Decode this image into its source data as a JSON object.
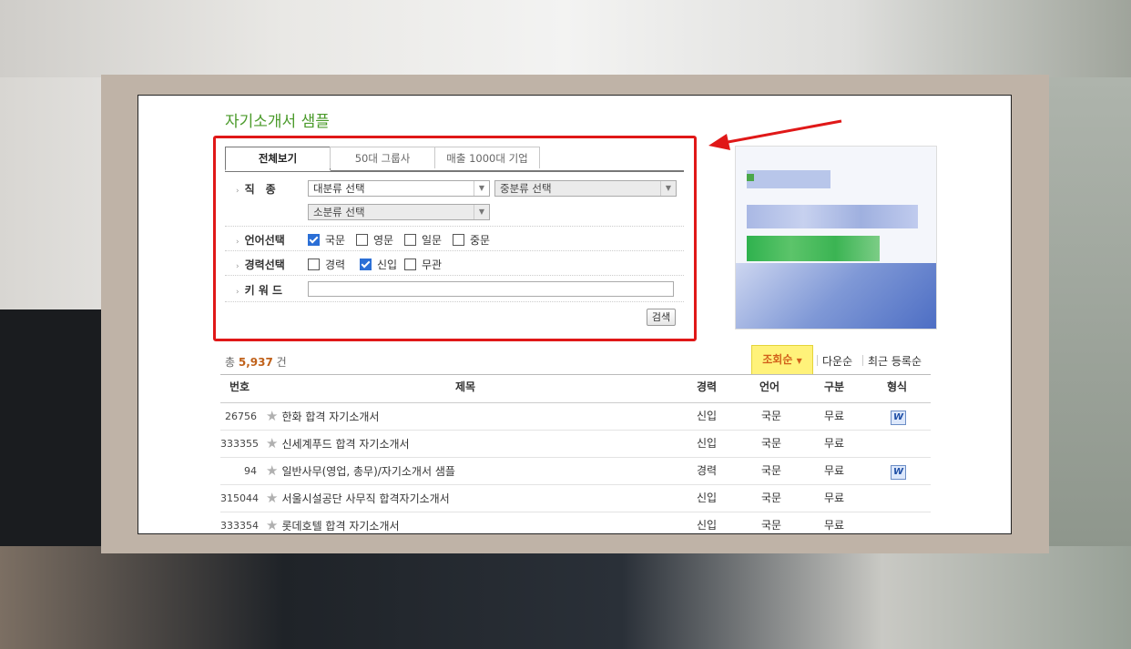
{
  "page_title": "자기소개서 샘플",
  "tabs": [
    {
      "label": "전체보기"
    },
    {
      "label": "50대 그룹사"
    },
    {
      "label": "매출 1000대 기업"
    }
  ],
  "filters": {
    "job_label": "직　종",
    "select_major": "대분류 선택",
    "select_middle": "중분류 선택",
    "select_minor": "소분류 선택",
    "lang_label": "언어선택",
    "lang_options": [
      {
        "label": "국문",
        "checked": true
      },
      {
        "label": "영문",
        "checked": false
      },
      {
        "label": "일문",
        "checked": false
      },
      {
        "label": "중문",
        "checked": false
      }
    ],
    "career_label": "경력선택",
    "career_options": [
      {
        "label": "경력",
        "checked": false
      },
      {
        "label": "신입",
        "checked": true
      },
      {
        "label": "무관",
        "checked": false
      }
    ],
    "keyword_label": "키 워 드",
    "keyword_value": "",
    "search_button": "검색"
  },
  "results": {
    "count_prefix": "총",
    "count_value": "5,937",
    "count_suffix": "건",
    "sort_active": "조회순",
    "sort_download": "다운순",
    "sort_recent": "최근 등록순"
  },
  "table": {
    "headers": [
      "번호",
      "제목",
      "경력",
      "언어",
      "구분",
      "형식"
    ],
    "rows": [
      {
        "no": "26756",
        "title": "한화 합격 자기소개서",
        "career": "신입",
        "lang": "국문",
        "type": "무료",
        "doc": "W"
      },
      {
        "no": "333355",
        "title": "신세계푸드 합격 자기소개서",
        "career": "신입",
        "lang": "국문",
        "type": "무료",
        "doc": ""
      },
      {
        "no": "94",
        "title": "일반사무(영업, 총무)/자기소개서 샘플",
        "career": "경력",
        "lang": "국문",
        "type": "무료",
        "doc": "W"
      },
      {
        "no": "315044",
        "title": "서울시설공단 사무직 합격자기소개서",
        "career": "신입",
        "lang": "국문",
        "type": "무료",
        "doc": ""
      },
      {
        "no": "333354",
        "title": "롯데호텔 합격 자기소개서",
        "career": "신입",
        "lang": "국문",
        "type": "무료",
        "doc": ""
      }
    ]
  },
  "colors": {
    "title_green": "#4a9a2a",
    "highlight_red": "#e01818",
    "sort_highlight": "#fff27a",
    "count_orange": "#c0611a"
  }
}
